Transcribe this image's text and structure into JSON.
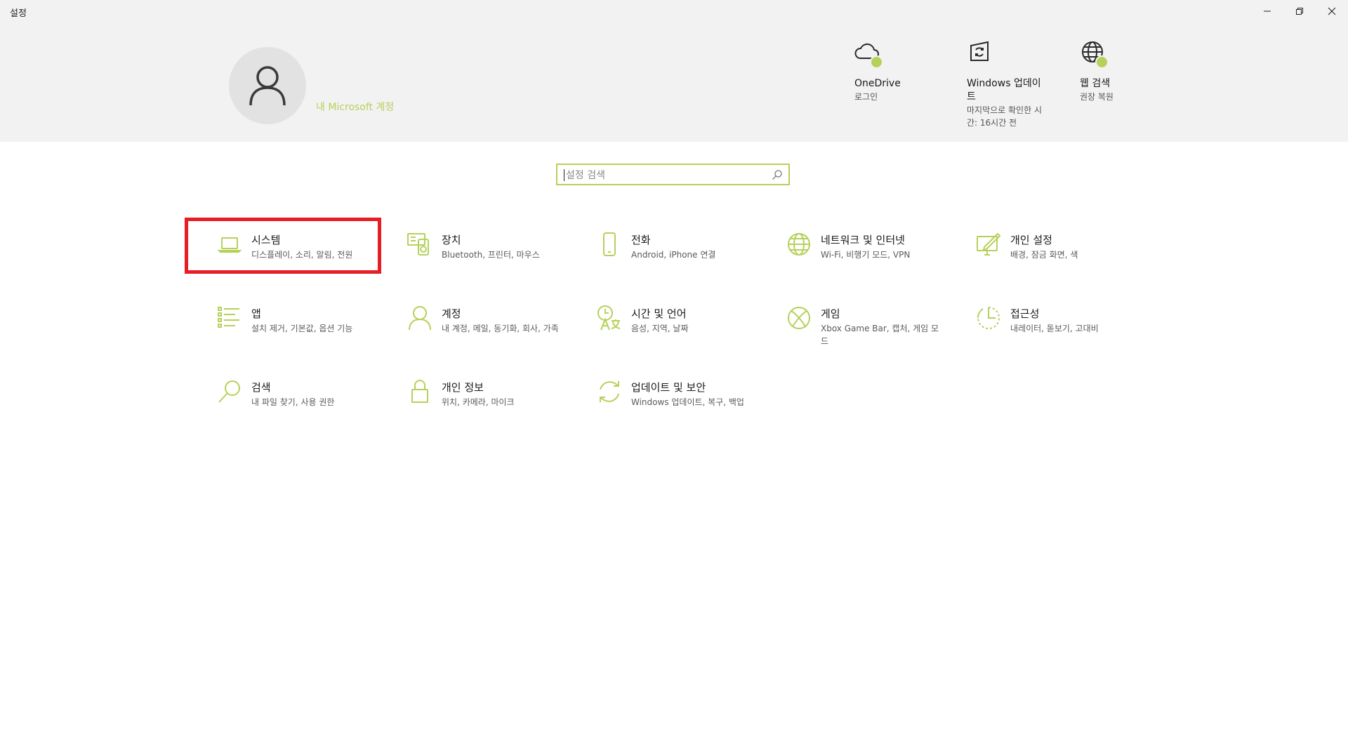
{
  "window": {
    "title": "설정",
    "controls": {
      "minimize_icon": "minimize-icon",
      "restore_icon": "restore-icon",
      "close_icon": "close-icon"
    }
  },
  "accent_color": "#b6d15a",
  "highlight_color": "#e81c24",
  "account": {
    "link": "내 Microsoft 계정",
    "icon": "user-avatar-icon"
  },
  "status": [
    {
      "title": "OneDrive",
      "sub": "로그인",
      "icon": "cloud-icon"
    },
    {
      "title": "Windows 업데이트",
      "sub": "마지막으로 확인한 시간: 16시간 전",
      "icon": "update-icon"
    },
    {
      "title": "웹 검색",
      "sub": "권장 복원",
      "icon": "globe-icon"
    }
  ],
  "search": {
    "placeholder": "설정 검색",
    "icon": "search-icon"
  },
  "categories": [
    {
      "name": "시스템",
      "desc": "디스플레이, 소리, 알림, 전원",
      "icon": "laptop-icon",
      "selected": true
    },
    {
      "name": "장치",
      "desc": "Bluetooth, 프린터, 마우스",
      "icon": "devices-icon"
    },
    {
      "name": "전화",
      "desc": "Android, iPhone 연결",
      "icon": "phone-icon"
    },
    {
      "name": "네트워크 및 인터넷",
      "desc": "Wi-Fi, 비행기 모드, VPN",
      "icon": "globe-icon"
    },
    {
      "name": "개인 설정",
      "desc": "배경, 잠금 화면, 색",
      "icon": "personalization-icon"
    },
    {
      "name": "앱",
      "desc": "설치 제거, 기본값, 옵션 기능",
      "icon": "apps-list-icon"
    },
    {
      "name": "계정",
      "desc": "내 계정, 메일, 동기화, 회사, 가족",
      "icon": "person-icon"
    },
    {
      "name": "시간 및 언어",
      "desc": "음성, 지역, 날짜",
      "icon": "time-language-icon"
    },
    {
      "name": "게임",
      "desc": "Xbox Game Bar, 캡처, 게임 모드",
      "icon": "xbox-icon"
    },
    {
      "name": "접근성",
      "desc": "내레이터, 돋보기, 고대비",
      "icon": "accessibility-icon"
    },
    {
      "name": "검색",
      "desc": "내 파일 찾기, 사용 권한",
      "icon": "search-icon"
    },
    {
      "name": "개인 정보",
      "desc": "위치, 카메라, 마이크",
      "icon": "lock-icon"
    },
    {
      "name": "업데이트 및 보안",
      "desc": "Windows 업데이트, 복구, 백업",
      "icon": "sync-icon"
    }
  ]
}
